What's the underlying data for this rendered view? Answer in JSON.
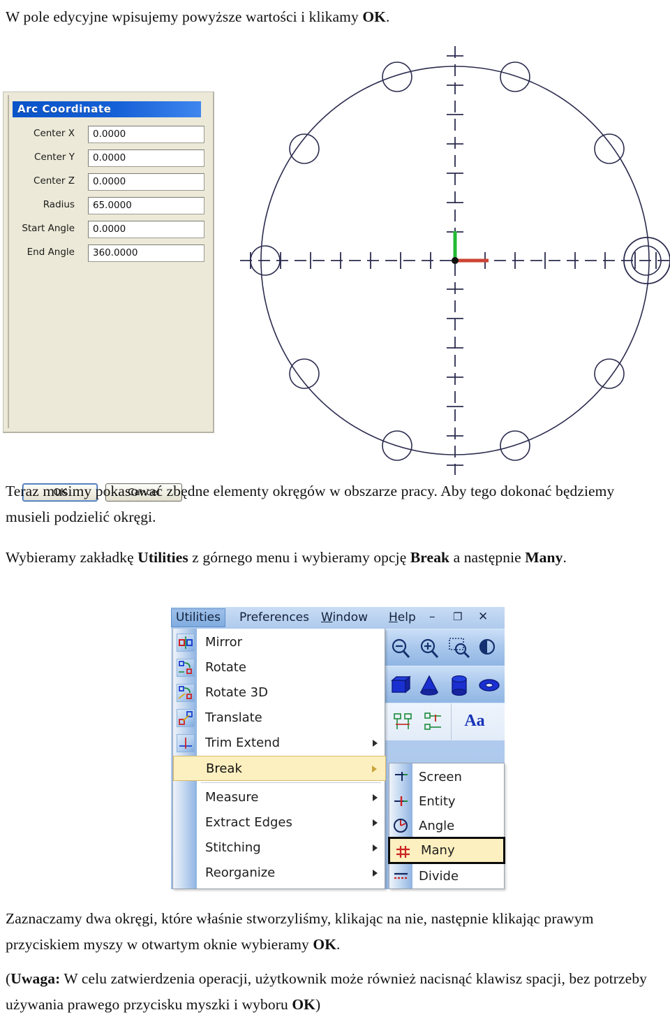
{
  "document": {
    "paragraphs": [
      {
        "id": "intro",
        "runs": [
          {
            "text": "W pole edycyjne wpisujemy powyższe wartości i klikamy ",
            "bold": false
          },
          {
            "text": "OK",
            "bold": true
          },
          {
            "text": ".",
            "bold": false
          }
        ]
      },
      {
        "id": "zoom-note",
        "runs": [
          {
            "text": "Teraz musimy pokasować zbędne elementy okręgów w obszarze pracy. Aby tego dokonać będziemy musieli podzielić okręgi.",
            "bold": false
          }
        ]
      },
      {
        "id": "utilities-note",
        "runs": [
          {
            "text": "Wybieramy zakładkę ",
            "bold": false
          },
          {
            "text": "Utilities",
            "bold": true
          },
          {
            "text": " z górnego menu i wybieramy opcję ",
            "bold": false
          },
          {
            "text": "Break",
            "bold": true
          },
          {
            "text": " a następnie ",
            "bold": false
          },
          {
            "text": "Many",
            "bold": true
          },
          {
            "text": ".",
            "bold": false
          }
        ]
      },
      {
        "id": "select-note",
        "runs": [
          {
            "text": "Zaznaczamy dwa okręgi, które właśnie stworzyliśmy, klikając na nie, następnie klikając prawym przyciskiem myszy w otwartym oknie wybieramy ",
            "bold": false
          },
          {
            "text": "OK",
            "bold": true
          },
          {
            "text": ".",
            "bold": false
          }
        ]
      },
      {
        "id": "caution-note",
        "runs": [
          {
            "text": " (",
            "bold": false
          },
          {
            "text": "Uwaga:",
            "bold": true
          },
          {
            "text": " W celu zatwierdzenia operacji, użytkownik może również nacisnąć klawisz spacji, bez potrzeby używania prawego przycisku myszki i wyboru ",
            "bold": false
          },
          {
            "text": "OK",
            "bold": true
          },
          {
            "text": ")",
            "bold": false
          }
        ]
      }
    ]
  },
  "arc_dialog": {
    "title": "Arc Coordinate",
    "fields": [
      {
        "label": "Center X",
        "value": "0.0000"
      },
      {
        "label": "Center Y",
        "value": "0.0000"
      },
      {
        "label": "Center Z",
        "value": "0.0000"
      },
      {
        "label": "Radius",
        "value": "65.0000"
      },
      {
        "label": "Start Angle",
        "value": "0.0000"
      },
      {
        "label": "End Angle",
        "value": "360.0000"
      }
    ],
    "buttons": {
      "ok": "OK",
      "cancel": "Cancel"
    },
    "colors": {
      "titlebar_start": "#0a53c8",
      "titlebar_end": "#3f86ee",
      "dialog_face": "#ece9d8",
      "input_bg": "#ffffff"
    }
  },
  "cad_view": {
    "entity": "circle",
    "radius": "65.0000",
    "center": {
      "x": "0.0000",
      "y": "0.0000",
      "z": "0.0000"
    },
    "start_angle": "0.0000",
    "end_angle": "360.0000",
    "axis_colors": {
      "x_axis": "#cc4433",
      "y_axis": "#22bb33",
      "origin": "#111111",
      "geometry": "#2b2b4f"
    },
    "small_circle_count": 10,
    "centerline_style": "dashed"
  },
  "menu_window": {
    "menubar": [
      {
        "label": "Utilities",
        "accel_index": -1,
        "active": true
      },
      {
        "label": "Preferences",
        "accel_index": -1,
        "active": false
      },
      {
        "label": "Window",
        "accel_index": 0,
        "active": false
      },
      {
        "label": "Help",
        "accel_index": 0,
        "active": false
      }
    ],
    "window_controls": [
      {
        "name": "minimize",
        "glyph": "–"
      },
      {
        "name": "restore",
        "glyph": "❐"
      },
      {
        "name": "close",
        "glyph": "✕"
      }
    ],
    "dropdown": {
      "owner": "Utilities",
      "items": [
        {
          "label": "Mirror",
          "icon": "mirror-icon",
          "submenu": false,
          "highlighted": false,
          "separator_after": false
        },
        {
          "label": "Rotate",
          "icon": "rotate-icon",
          "submenu": false,
          "highlighted": false,
          "separator_after": false
        },
        {
          "label": "Rotate 3D",
          "icon": "rotate-3d-icon",
          "submenu": false,
          "highlighted": false,
          "separator_after": false
        },
        {
          "label": "Translate",
          "icon": "translate-icon",
          "submenu": false,
          "highlighted": false,
          "separator_after": false
        },
        {
          "label": "Trim Extend",
          "icon": "trim-extend-icon",
          "submenu": true,
          "highlighted": false,
          "separator_after": false
        },
        {
          "label": "Break",
          "icon": "break-icon",
          "submenu": true,
          "highlighted": true,
          "separator_after": true
        },
        {
          "label": "Measure",
          "icon": "measure-icon",
          "submenu": true,
          "highlighted": false,
          "separator_after": false
        },
        {
          "label": "Extract Edges",
          "icon": "extract-edges-icon",
          "submenu": true,
          "highlighted": false,
          "separator_after": false
        },
        {
          "label": "Stitching",
          "icon": "stitching-icon",
          "submenu": true,
          "highlighted": false,
          "separator_after": false
        },
        {
          "label": "Reorganize",
          "icon": "reorganize-icon",
          "submenu": true,
          "highlighted": false,
          "separator_after": false
        }
      ]
    },
    "submenu": {
      "owner": "Break",
      "items": [
        {
          "label": "Screen",
          "icon": "break-screen-icon",
          "selected": false
        },
        {
          "label": "Entity",
          "icon": "break-entity-icon",
          "selected": false
        },
        {
          "label": "Angle",
          "icon": "break-angle-icon",
          "selected": false
        },
        {
          "label": "Many",
          "icon": "break-many-icon",
          "selected": true
        },
        {
          "label": "Divide",
          "icon": "break-divide-icon",
          "selected": false
        }
      ]
    },
    "toolbar": {
      "row1": [
        "zoom-out-icon",
        "zoom-in-icon",
        "zoom-window-icon",
        "zoom-previous-icon"
      ],
      "row2": [
        "box-solid-icon",
        "cone-solid-icon",
        "cylinder-solid-icon",
        "torus-solid-icon"
      ],
      "row3": [
        "dimension-icon",
        "leader-icon",
        "text-icon"
      ],
      "row3_text_label": "Aa"
    },
    "colors": {
      "menubar_bg": "#b3cdee",
      "highlight_bg": "#fdf0c0",
      "highlight_border": "#d9b96a",
      "selection_border": "#0b0b0b"
    }
  }
}
